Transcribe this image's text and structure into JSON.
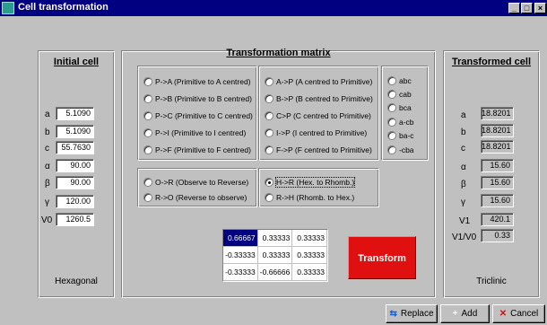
{
  "window": {
    "title": "Cell transformation",
    "min_label": "_",
    "max_label": "□",
    "close_label": "×"
  },
  "initial": {
    "title": "Initial cell",
    "rows": [
      {
        "label": "a",
        "value": "5.1090"
      },
      {
        "label": "b",
        "value": "5.1090"
      },
      {
        "label": "c",
        "value": "55.7630"
      },
      {
        "label": "α",
        "value": "90.00"
      },
      {
        "label": "β",
        "value": "90.00"
      },
      {
        "label": "γ",
        "value": "120.00"
      },
      {
        "label": "V0",
        "value": "1260.5"
      }
    ],
    "system": "Hexagonal"
  },
  "matrix_panel": {
    "title": "Transformation matrix",
    "left_options": [
      "P->A (Primitive to A centred)",
      "P->B (Primitive to B centred)",
      "P->C (Primitive to C centred)",
      "P->I (Primitive to I centred)",
      "P->F (Primitive to F centred)"
    ],
    "right_options": [
      "A->P (A centred to Primitive)",
      "B->P (B centred to Primitive)",
      "C>P (C centred to Primitive)",
      "I->P (I centred to Primitive)",
      "F->P (F centred to Primitive)"
    ],
    "axis_options": [
      "abc",
      "cab",
      "bca",
      "a-cb",
      "ba-c",
      "-cba"
    ],
    "obverse_options": [
      "O->R (Observe to Reverse)",
      "R->O (Reverse to observe)"
    ],
    "hex_options": [
      "H->R (Hex. to Rhomb.)",
      "R->H (Rhomb. to Hex.)"
    ],
    "selected_option": "H->R (Hex. to Rhomb.)",
    "matrix": [
      [
        "0.66667",
        "0.33333",
        "0.33333"
      ],
      [
        "-0.33333",
        "0.33333",
        "0.33333"
      ],
      [
        "-0.33333",
        "-0.66666",
        "0.33333"
      ]
    ],
    "transform_label": "Transform"
  },
  "transformed": {
    "title": "Transformed cell",
    "rows": [
      {
        "label": "a",
        "value": "18.8201"
      },
      {
        "label": "b",
        "value": "18.8201"
      },
      {
        "label": "c",
        "value": "18.8201"
      },
      {
        "label": "α",
        "value": "15.60"
      },
      {
        "label": "β",
        "value": "15.60"
      },
      {
        "label": "γ",
        "value": "15.60"
      },
      {
        "label": "V1",
        "value": "420.1"
      },
      {
        "label": "V1/V0",
        "value": "0.33"
      }
    ],
    "system": "Triclinic"
  },
  "buttons": {
    "replace": "Replace",
    "add": "Add",
    "cancel": "Cancel"
  }
}
